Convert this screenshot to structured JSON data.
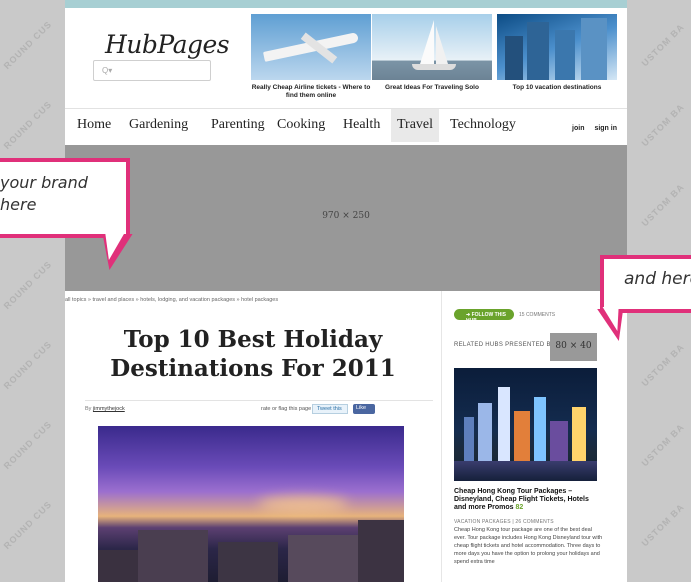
{
  "background": {
    "watermark_left": "ROUND CUS",
    "watermark_right": "USTOM BA",
    "colors": {
      "teal": "#a7cfd3",
      "gray": "#c9c9c9",
      "magenta": "#e0307a"
    }
  },
  "header": {
    "logo": "HubPages",
    "search_placeholder": "Q▾",
    "promos": [
      {
        "caption": "Really Cheap Airline tickets - Where to find them online",
        "icon": "airplane-image"
      },
      {
        "caption": "Great Ideas For Traveling Solo",
        "icon": "sailboat-image"
      },
      {
        "caption": "Top 10 vacation destinations",
        "icon": "skyscraper-image"
      }
    ]
  },
  "nav": {
    "items": [
      "Home",
      "Gardening",
      "Parenting",
      "Cooking",
      "Health",
      "Travel",
      "Technology"
    ],
    "active": "Travel",
    "join": "join",
    "signin": "sign in"
  },
  "banner": {
    "size_label": "970 × 250"
  },
  "article": {
    "breadcrumb": "all topics » travel and places  » hotels, lodging, and vacation packages » hotel packages",
    "title": "Top 10 Best Holiday Destinations For 2011",
    "by_label": "By",
    "author": "jimmythejock",
    "rate_label": "rate or flag this page",
    "tweet_label": "Tweet this",
    "like_label": "Like"
  },
  "sidebar": {
    "follow_label": "➜ FOLLOW THIS HUB",
    "comments_label": "15 COMMENTS",
    "related_label": "RELATED HUBS PRESENTED BY",
    "ad_size": "80 × 40",
    "related": {
      "title": "Cheap Hong Kong Tour Packages – Disneyland, Cheap Flight Tickets, Hotels and more Promos",
      "score": "82",
      "meta": "VACATION PACKAGES | 26 COMMENTS",
      "description": "Cheap Hong Kong tour package are one of the best deal ever. Tour package includes Hong Kong Disneyland tour with cheap flight tickets and hotel accommodation. Three days to more days you have the option to prolong your holidays and spend extra time"
    }
  },
  "callouts": {
    "left": "your brand here",
    "right": "and here"
  }
}
